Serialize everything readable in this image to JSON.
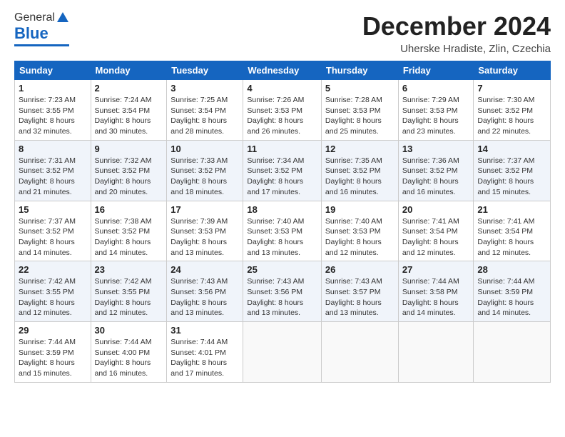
{
  "logo": {
    "general": "General",
    "blue": "Blue"
  },
  "header": {
    "month": "December 2024",
    "location": "Uherske Hradiste, Zlin, Czechia"
  },
  "days_of_week": [
    "Sunday",
    "Monday",
    "Tuesday",
    "Wednesday",
    "Thursday",
    "Friday",
    "Saturday"
  ],
  "weeks": [
    [
      {
        "day": "1",
        "info": "Sunrise: 7:23 AM\nSunset: 3:55 PM\nDaylight: 8 hours\nand 32 minutes."
      },
      {
        "day": "2",
        "info": "Sunrise: 7:24 AM\nSunset: 3:54 PM\nDaylight: 8 hours\nand 30 minutes."
      },
      {
        "day": "3",
        "info": "Sunrise: 7:25 AM\nSunset: 3:54 PM\nDaylight: 8 hours\nand 28 minutes."
      },
      {
        "day": "4",
        "info": "Sunrise: 7:26 AM\nSunset: 3:53 PM\nDaylight: 8 hours\nand 26 minutes."
      },
      {
        "day": "5",
        "info": "Sunrise: 7:28 AM\nSunset: 3:53 PM\nDaylight: 8 hours\nand 25 minutes."
      },
      {
        "day": "6",
        "info": "Sunrise: 7:29 AM\nSunset: 3:53 PM\nDaylight: 8 hours\nand 23 minutes."
      },
      {
        "day": "7",
        "info": "Sunrise: 7:30 AM\nSunset: 3:52 PM\nDaylight: 8 hours\nand 22 minutes."
      }
    ],
    [
      {
        "day": "8",
        "info": "Sunrise: 7:31 AM\nSunset: 3:52 PM\nDaylight: 8 hours\nand 21 minutes."
      },
      {
        "day": "9",
        "info": "Sunrise: 7:32 AM\nSunset: 3:52 PM\nDaylight: 8 hours\nand 20 minutes."
      },
      {
        "day": "10",
        "info": "Sunrise: 7:33 AM\nSunset: 3:52 PM\nDaylight: 8 hours\nand 18 minutes."
      },
      {
        "day": "11",
        "info": "Sunrise: 7:34 AM\nSunset: 3:52 PM\nDaylight: 8 hours\nand 17 minutes."
      },
      {
        "day": "12",
        "info": "Sunrise: 7:35 AM\nSunset: 3:52 PM\nDaylight: 8 hours\nand 16 minutes."
      },
      {
        "day": "13",
        "info": "Sunrise: 7:36 AM\nSunset: 3:52 PM\nDaylight: 8 hours\nand 16 minutes."
      },
      {
        "day": "14",
        "info": "Sunrise: 7:37 AM\nSunset: 3:52 PM\nDaylight: 8 hours\nand 15 minutes."
      }
    ],
    [
      {
        "day": "15",
        "info": "Sunrise: 7:37 AM\nSunset: 3:52 PM\nDaylight: 8 hours\nand 14 minutes."
      },
      {
        "day": "16",
        "info": "Sunrise: 7:38 AM\nSunset: 3:52 PM\nDaylight: 8 hours\nand 14 minutes."
      },
      {
        "day": "17",
        "info": "Sunrise: 7:39 AM\nSunset: 3:53 PM\nDaylight: 8 hours\nand 13 minutes."
      },
      {
        "day": "18",
        "info": "Sunrise: 7:40 AM\nSunset: 3:53 PM\nDaylight: 8 hours\nand 13 minutes."
      },
      {
        "day": "19",
        "info": "Sunrise: 7:40 AM\nSunset: 3:53 PM\nDaylight: 8 hours\nand 12 minutes."
      },
      {
        "day": "20",
        "info": "Sunrise: 7:41 AM\nSunset: 3:54 PM\nDaylight: 8 hours\nand 12 minutes."
      },
      {
        "day": "21",
        "info": "Sunrise: 7:41 AM\nSunset: 3:54 PM\nDaylight: 8 hours\nand 12 minutes."
      }
    ],
    [
      {
        "day": "22",
        "info": "Sunrise: 7:42 AM\nSunset: 3:55 PM\nDaylight: 8 hours\nand 12 minutes."
      },
      {
        "day": "23",
        "info": "Sunrise: 7:42 AM\nSunset: 3:55 PM\nDaylight: 8 hours\nand 12 minutes."
      },
      {
        "day": "24",
        "info": "Sunrise: 7:43 AM\nSunset: 3:56 PM\nDaylight: 8 hours\nand 13 minutes."
      },
      {
        "day": "25",
        "info": "Sunrise: 7:43 AM\nSunset: 3:56 PM\nDaylight: 8 hours\nand 13 minutes."
      },
      {
        "day": "26",
        "info": "Sunrise: 7:43 AM\nSunset: 3:57 PM\nDaylight: 8 hours\nand 13 minutes."
      },
      {
        "day": "27",
        "info": "Sunrise: 7:44 AM\nSunset: 3:58 PM\nDaylight: 8 hours\nand 14 minutes."
      },
      {
        "day": "28",
        "info": "Sunrise: 7:44 AM\nSunset: 3:59 PM\nDaylight: 8 hours\nand 14 minutes."
      }
    ],
    [
      {
        "day": "29",
        "info": "Sunrise: 7:44 AM\nSunset: 3:59 PM\nDaylight: 8 hours\nand 15 minutes."
      },
      {
        "day": "30",
        "info": "Sunrise: 7:44 AM\nSunset: 4:00 PM\nDaylight: 8 hours\nand 16 minutes."
      },
      {
        "day": "31",
        "info": "Sunrise: 7:44 AM\nSunset: 4:01 PM\nDaylight: 8 hours\nand 17 minutes."
      },
      {
        "day": "",
        "info": ""
      },
      {
        "day": "",
        "info": ""
      },
      {
        "day": "",
        "info": ""
      },
      {
        "day": "",
        "info": ""
      }
    ]
  ]
}
